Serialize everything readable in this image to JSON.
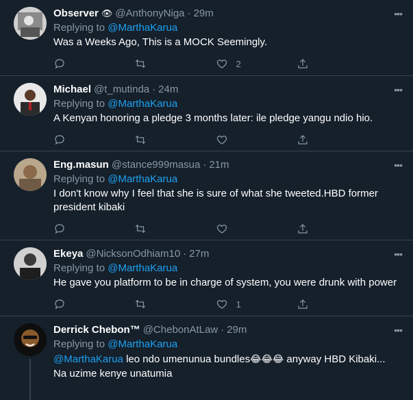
{
  "replying_label": "Replying to",
  "tweets": [
    {
      "name": "Observer",
      "emoji": "👁",
      "handle": "@AnthonyNiga",
      "time": "29m",
      "replying_to": "@MarthaKarua",
      "text": "Was a Weeks Ago, This is a MOCK Seemingly.",
      "likes": "2"
    },
    {
      "name": "Michael",
      "handle": "@t_mutinda",
      "time": "24m",
      "replying_to": "@MarthaKarua",
      "text": "A Kenyan honoring a pledge 3 months later: ile pledge yangu ndio hio."
    },
    {
      "name": "Eng.masun",
      "handle": "@stance999masua",
      "time": "21m",
      "replying_to": "@MarthaKarua",
      "text": "I don't know why I feel that she is sure of what she tweeted.HBD former president kibaki"
    },
    {
      "name": "Ekeya",
      "handle": "@NicksonOdhiam10",
      "time": "27m",
      "replying_to": "@MarthaKarua",
      "text": "He gave you platform to be in charge of system, you were drunk with power",
      "likes": "1"
    },
    {
      "name": "Derrick Chebon™",
      "handle": "@ChebonAtLaw",
      "time": "29m",
      "replying_to": "@MarthaKarua",
      "text_mention": "@MarthaKarua",
      "text_a": " leo ndo umenunua bundles",
      "text_emoji": "😂😂😂",
      "text_b": " anyway HBD Kibaki...",
      "text_c": "Na uzime kenye unatumia"
    }
  ],
  "colors": {
    "background": "#15202b",
    "muted": "#8899a6",
    "accent": "#1da1f2",
    "border": "#38444d"
  },
  "icons": [
    "reply-icon",
    "retweet-icon",
    "like-icon",
    "share-icon",
    "more-icon"
  ]
}
